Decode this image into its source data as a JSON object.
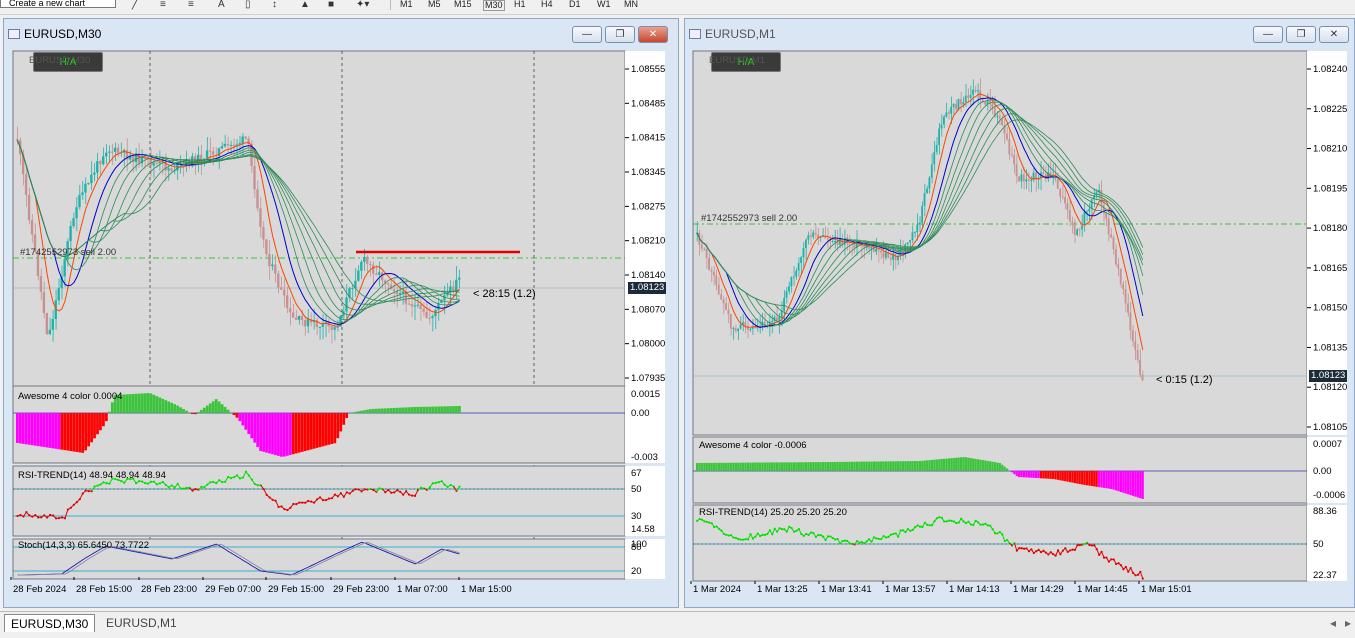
{
  "toolbar": {
    "tooltip_text": "Create a new chart",
    "timeframes": [
      "M1",
      "M5",
      "M15",
      "M30",
      "H1",
      "H4",
      "D1",
      "W1",
      "MN"
    ]
  },
  "colors": {
    "bull": "#20b2aa",
    "bear": "#c89090",
    "ao_up": "#3cc43c",
    "ao_down_magenta": "#ff00ff",
    "ao_down_red": "#ff0000",
    "rsi_up": "#00e000",
    "rsi_down": "#e00000",
    "stoch": "#1a1aa8",
    "level_line": "#00a0d0",
    "order_line": "#00c000",
    "red_line": "#e00000"
  },
  "left_chart": {
    "title": "EURUSD,M30",
    "symbol_label": "EURUSD,M30",
    "ha_label": "H/A",
    "order_label": "#1742552973 sell 2.00",
    "countdown": "< 28:15 (1.2)",
    "current_price": "1.08123",
    "price_ticks": [
      "1.08555",
      "1.08485",
      "1.08415",
      "1.08345",
      "1.08275",
      "1.08210",
      "1.08140",
      "1.08070",
      "1.08000",
      "1.07935"
    ],
    "ao_label": "Awesome 4 color 0.0004",
    "ao_ticks": [
      "0.0015",
      "0.00",
      "-0.003"
    ],
    "rsi_label": "RSI-TREND(14) 48.94 48.94 48.94",
    "rsi_ticks": [
      "67",
      "50",
      "30",
      "14.58"
    ],
    "stoch_label": "Stoch(14,3,3) 65.6450 73.7722",
    "stoch_ticks": [
      "100",
      "80",
      "20"
    ],
    "time_labels": [
      "28 Feb 2024",
      "28 Feb 15:00",
      "28 Feb 23:00",
      "29 Feb 07:00",
      "29 Feb 15:00",
      "29 Feb 23:00",
      "1 Mar 07:00",
      "1 Mar 15:00"
    ]
  },
  "right_chart": {
    "title": "EURUSD,M1",
    "symbol_label": "EURUSD,M1",
    "ha_label": "H/A",
    "order_label": "#1742552973 sell 2.00",
    "countdown": "< 0:15 (1.2)",
    "current_price": "1.08123",
    "price_ticks": [
      "1.08240",
      "1.08225",
      "1.08210",
      "1.08195",
      "1.08180",
      "1.08165",
      "1.08150",
      "1.08135",
      "1.08120",
      "1.08105"
    ],
    "ao_label": "Awesome 4 color -0.0006",
    "ao_ticks": [
      "0.0007",
      "0.00",
      "-0.0006"
    ],
    "rsi_label": "RSI-TREND(14) 25.20 25.20 25.20",
    "rsi_ticks": [
      "88.36",
      "50",
      "22.37"
    ],
    "time_labels": [
      "1 Mar 2024",
      "1 Mar 13:25",
      "1 Mar 13:41",
      "1 Mar 13:57",
      "1 Mar 14:13",
      "1 Mar 14:29",
      "1 Mar 14:45",
      "1 Mar 15:01"
    ]
  },
  "tabs": [
    {
      "label": "EURUSD,M30",
      "active": true
    },
    {
      "label": "EURUSD,M1",
      "active": false
    }
  ]
}
